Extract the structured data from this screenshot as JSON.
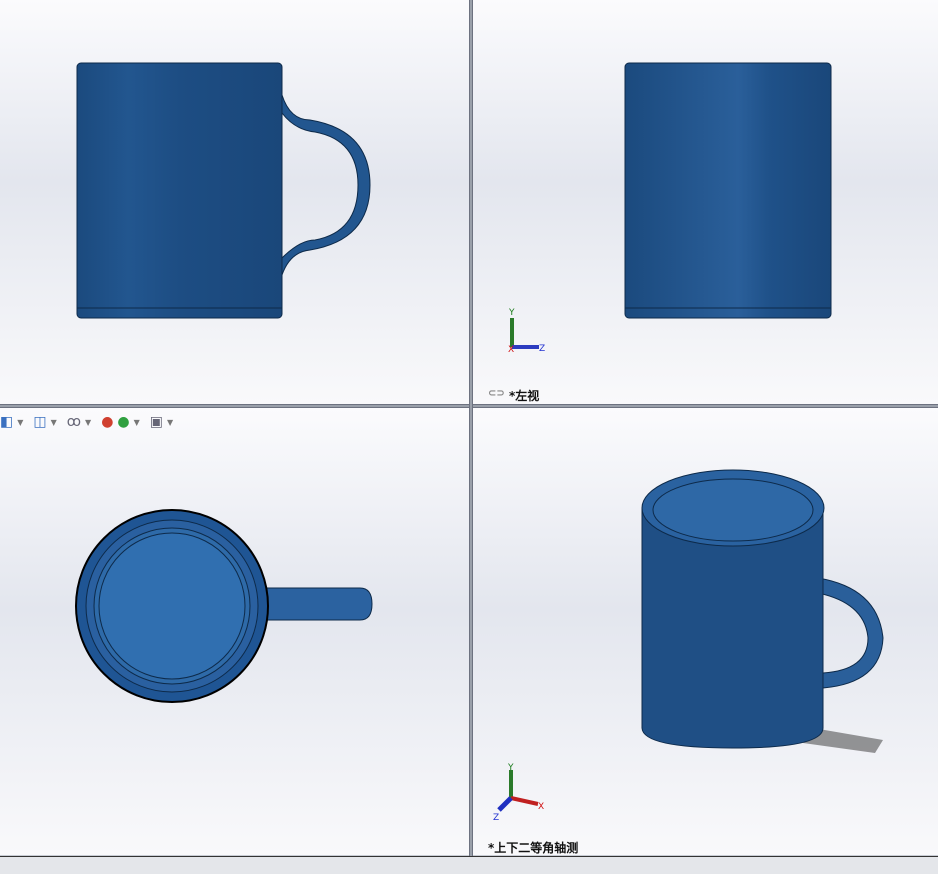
{
  "viewports": {
    "top_left": {
      "name": "front-view"
    },
    "top_right": {
      "label": "*左视"
    },
    "bottom_left": {
      "name": "top-view"
    },
    "bottom_right": {
      "label": "*上下二等角轴测"
    }
  },
  "triad": {
    "x": "X",
    "y": "Y",
    "z": "Z"
  },
  "toolbar": {
    "icons": [
      "view-orientation-icon",
      "display-style-icon",
      "hide-show-icon",
      "edit-appearance-icon",
      "apply-scene-icon",
      "view-settings-icon"
    ]
  },
  "colors": {
    "mug": "#1f4f85",
    "mug_light": "#2e6aa6",
    "background": "#eef0f5"
  }
}
